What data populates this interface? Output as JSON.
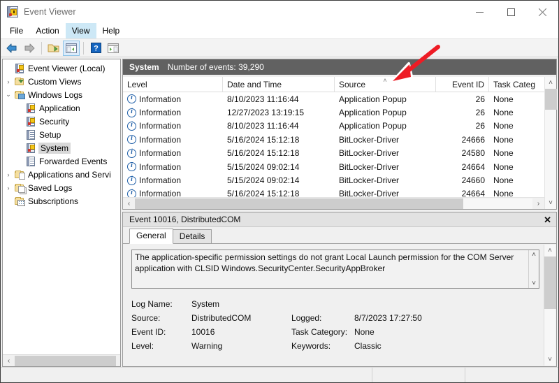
{
  "window": {
    "title": "Event Viewer",
    "app_icon": "event-log-icon",
    "minimize": "—",
    "maximize": "□",
    "close": "✕"
  },
  "menubar": {
    "items": [
      {
        "label": "File",
        "active": false
      },
      {
        "label": "Action",
        "active": false
      },
      {
        "label": "View",
        "active": true
      },
      {
        "label": "Help",
        "active": false
      }
    ]
  },
  "toolbar": {
    "buttons": [
      {
        "name": "back-arrow-icon",
        "pressed": false
      },
      {
        "name": "forward-arrow-icon",
        "pressed": false
      },
      {
        "name": "open-folder-icon",
        "pressed": false
      },
      {
        "name": "show-hide-console-tree-icon",
        "pressed": true
      },
      {
        "name": "help-icon",
        "pressed": false
      },
      {
        "name": "show-hide-action-pane-icon",
        "pressed": false
      }
    ]
  },
  "tree": {
    "nodes": [
      {
        "label": "Event Viewer (Local)",
        "indent": 0,
        "twisty": "",
        "icon": "event-log-icon",
        "selected": false
      },
      {
        "label": "Custom Views",
        "indent": 1,
        "twisty": "›",
        "icon": "folder-funnel-icon",
        "selected": false
      },
      {
        "label": "Windows Logs",
        "indent": 1,
        "twisty": "⌄",
        "icon": "folder-monitor-icon",
        "selected": false
      },
      {
        "label": "Application",
        "indent": 2,
        "twisty": "",
        "icon": "log-warning-icon",
        "selected": false
      },
      {
        "label": "Security",
        "indent": 2,
        "twisty": "",
        "icon": "log-warning-icon",
        "selected": false
      },
      {
        "label": "Setup",
        "indent": 2,
        "twisty": "",
        "icon": "log-icon",
        "selected": false
      },
      {
        "label": "System",
        "indent": 2,
        "twisty": "",
        "icon": "log-warning-icon",
        "selected": true
      },
      {
        "label": "Forwarded Events",
        "indent": 2,
        "twisty": "",
        "icon": "log-icon",
        "selected": false
      },
      {
        "label": "Applications and Servi",
        "indent": 1,
        "twisty": "›",
        "icon": "folder-sheet-icon",
        "selected": false
      },
      {
        "label": "Saved Logs",
        "indent": 1,
        "twisty": "›",
        "icon": "folder-stack-icon",
        "selected": false
      },
      {
        "label": "Subscriptions",
        "indent": 1,
        "twisty": "",
        "icon": "folder-subscriptions-icon",
        "selected": false
      }
    ]
  },
  "list": {
    "banner_title": "System",
    "banner_count": "Number of events: 39,290",
    "columns": [
      {
        "label": "Level",
        "sorted": false
      },
      {
        "label": "Date and Time",
        "sorted": false
      },
      {
        "label": "Source",
        "sorted": true,
        "sort_caret": "˄"
      },
      {
        "label": "Event ID",
        "sorted": false
      },
      {
        "label": "Task Categ",
        "sorted": false
      }
    ],
    "rows": [
      {
        "level": "Information",
        "date": "8/10/2023 11:16:44",
        "source": "Application Popup",
        "event_id": "26",
        "task": "None"
      },
      {
        "level": "Information",
        "date": "12/27/2023 13:19:15",
        "source": "Application Popup",
        "event_id": "26",
        "task": "None"
      },
      {
        "level": "Information",
        "date": "8/10/2023 11:16:44",
        "source": "Application Popup",
        "event_id": "26",
        "task": "None"
      },
      {
        "level": "Information",
        "date": "5/16/2024 15:12:18",
        "source": "BitLocker-Driver",
        "event_id": "24666",
        "task": "None"
      },
      {
        "level": "Information",
        "date": "5/16/2024 15:12:18",
        "source": "BitLocker-Driver",
        "event_id": "24580",
        "task": "None"
      },
      {
        "level": "Information",
        "date": "5/15/2024 09:02:14",
        "source": "BitLocker-Driver",
        "event_id": "24664",
        "task": "None"
      },
      {
        "level": "Information",
        "date": "5/15/2024 09:02:14",
        "source": "BitLocker-Driver",
        "event_id": "24660",
        "task": "None"
      },
      {
        "level": "Information",
        "date": "5/16/2024 15:12:18",
        "source": "BitLocker-Driver",
        "event_id": "24664",
        "task": "None"
      }
    ]
  },
  "detail": {
    "banner": "Event 10016, DistributedCOM",
    "close_label": "✕",
    "tabs": [
      {
        "label": "General",
        "active": true
      },
      {
        "label": "Details",
        "active": false
      }
    ],
    "description": "The application-specific permission settings do not grant Local Launch permission for the COM Server application with CLSID\nWindows.SecurityCenter.SecurityAppBroker",
    "fields": [
      {
        "label": "Log Name:",
        "value": "System",
        "label2": "",
        "value2": ""
      },
      {
        "label": "Source:",
        "value": "DistributedCOM",
        "label2": "Logged:",
        "value2": "8/7/2023 17:27:50"
      },
      {
        "label": "Event ID:",
        "value": "10016",
        "label2": "Task Category:",
        "value2": "None"
      },
      {
        "label": "Level:",
        "value": "Warning",
        "label2": "Keywords:",
        "value2": "Classic"
      }
    ]
  },
  "scrollbars": {
    "up_arrow": "˄",
    "down_arrow": "˅",
    "left_arrow": "‹",
    "right_arrow": "›"
  },
  "annotation": {
    "type": "red-arrow",
    "color": "#ee1c25",
    "points_to": "source-column-sort-indicator"
  }
}
